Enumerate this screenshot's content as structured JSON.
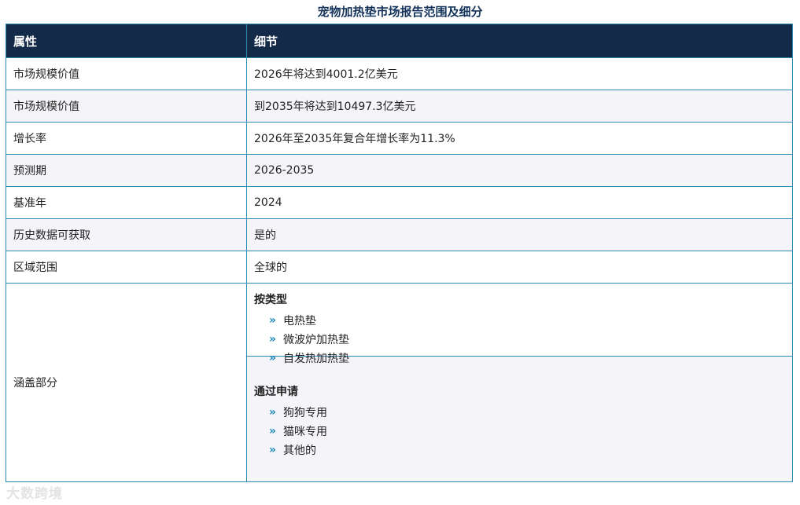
{
  "title": "宠物加热垫市场报告范围及细分",
  "header": {
    "col1": "属性",
    "col2": "细节"
  },
  "rows": [
    {
      "attr": "市场规模价值",
      "detail": "2026年将达到4001.2亿美元"
    },
    {
      "attr": "市场规模价值",
      "detail": "到2035年将达到10497.3亿美元"
    },
    {
      "attr": "增长率",
      "detail": "2026年至2035年复合年增长率为11.3%"
    },
    {
      "attr": "预测期",
      "detail": "2026-2035"
    },
    {
      "attr": "基准年",
      "detail": "2024"
    },
    {
      "attr": "历史数据可获取",
      "detail": "是的"
    },
    {
      "attr": "区域范围",
      "detail": "全球的"
    }
  ],
  "segments": {
    "attr": "涵盖部分",
    "groups": [
      {
        "heading": "按类型",
        "items": [
          "电热垫",
          "微波炉加热垫",
          "自发热加热垫"
        ]
      },
      {
        "heading": "通过申请",
        "items": [
          "狗狗专用",
          "猫咪专用",
          "其他的"
        ]
      }
    ]
  },
  "watermark": "大数跨境"
}
